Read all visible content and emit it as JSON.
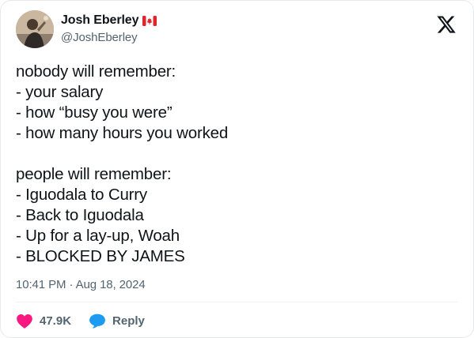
{
  "author": {
    "display_name": "Josh Eberley",
    "handle": "@JoshEberley",
    "flag_icon": "canada-flag-icon"
  },
  "logo_icon": "x-logo-icon",
  "tweet": {
    "lines": [
      "nobody will remember:",
      "- your salary",
      "- how “busy you were”",
      "- how many hours you worked",
      "",
      "people will remember:",
      "- Iguodala to Curry",
      "- Back to Iguodala",
      "- Up for a lay-up, Woah",
      "- BLOCKED BY JAMES"
    ],
    "timestamp": "10:41 PM · Aug 18, 2024"
  },
  "actions": {
    "like": {
      "icon": "heart-icon",
      "count": "47.9K",
      "color": "#f91880"
    },
    "reply": {
      "icon": "speech-bubble-icon",
      "label": "Reply",
      "color": "#1d9bf0"
    }
  },
  "colors": {
    "text": "#0f1419",
    "muted": "#536471",
    "border": "#e6e9ec"
  }
}
